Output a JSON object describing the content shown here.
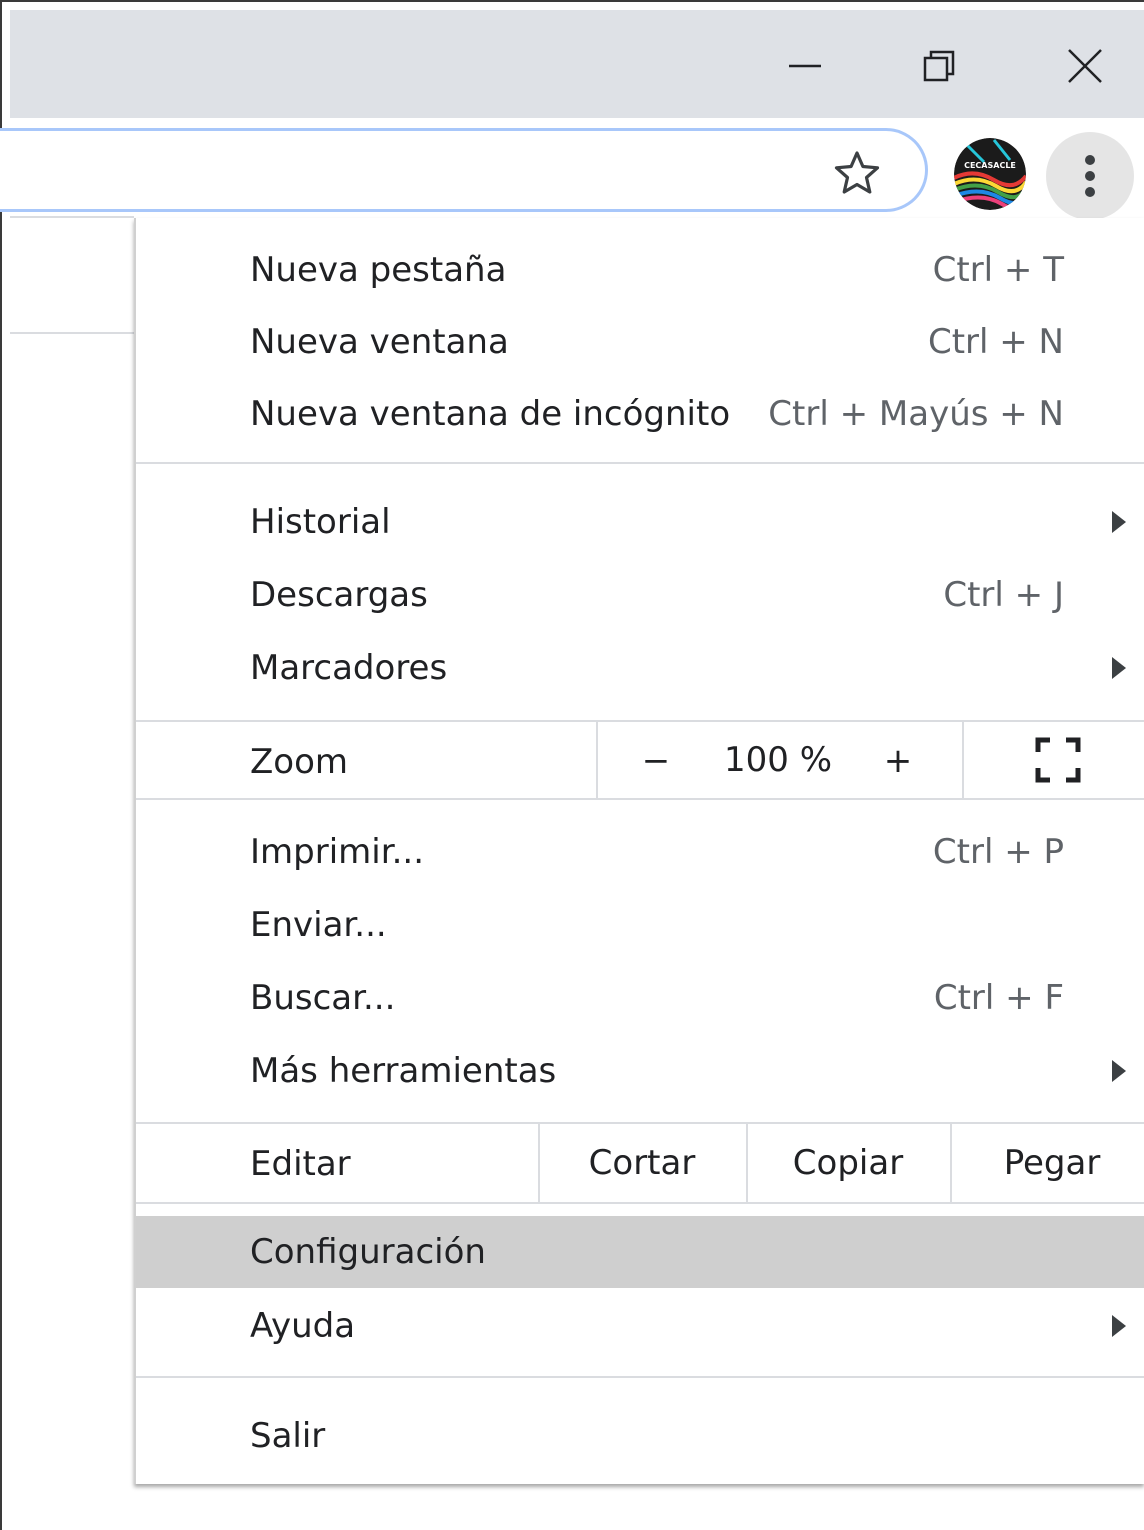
{
  "window_controls": {
    "minimize_icon": "minimize-icon",
    "restore_icon": "restore-icon",
    "close_icon": "close-icon"
  },
  "toolbar": {
    "bookmark_icon": "star-icon",
    "profile_avatar_text": "CECASACLE",
    "menu_icon": "three-dots-vertical-icon"
  },
  "menu": {
    "group1": [
      {
        "label": "Nueva pestaña",
        "shortcut": "Ctrl + T"
      },
      {
        "label": "Nueva ventana",
        "shortcut": "Ctrl + N"
      },
      {
        "label": "Nueva ventana de incógnito",
        "shortcut": "Ctrl + Mayús + N"
      }
    ],
    "group2": [
      {
        "label": "Historial",
        "submenu": true
      },
      {
        "label": "Descargas",
        "shortcut": "Ctrl + J"
      },
      {
        "label": "Marcadores",
        "submenu": true
      }
    ],
    "zoom": {
      "label": "Zoom",
      "minus": "−",
      "value": "100 %",
      "plus": "+",
      "fullscreen_icon": "fullscreen-icon"
    },
    "group3": [
      {
        "label": "Imprimir...",
        "shortcut": "Ctrl + P"
      },
      {
        "label": "Enviar..."
      },
      {
        "label": "Buscar...",
        "shortcut": "Ctrl + F"
      },
      {
        "label": "Más herramientas",
        "submenu": true
      }
    ],
    "edit": {
      "label": "Editar",
      "cut": "Cortar",
      "copy": "Copiar",
      "paste": "Pegar"
    },
    "group4": [
      {
        "label": "Configuración",
        "highlighted": true
      },
      {
        "label": "Ayuda",
        "submenu": true
      }
    ],
    "exit": {
      "label": "Salir"
    }
  },
  "colors": {
    "titlebar": "#dee1e6",
    "omnibox_focus": "#a8c7fa",
    "highlight": "#cfcfcf",
    "separator": "#dadce0"
  }
}
